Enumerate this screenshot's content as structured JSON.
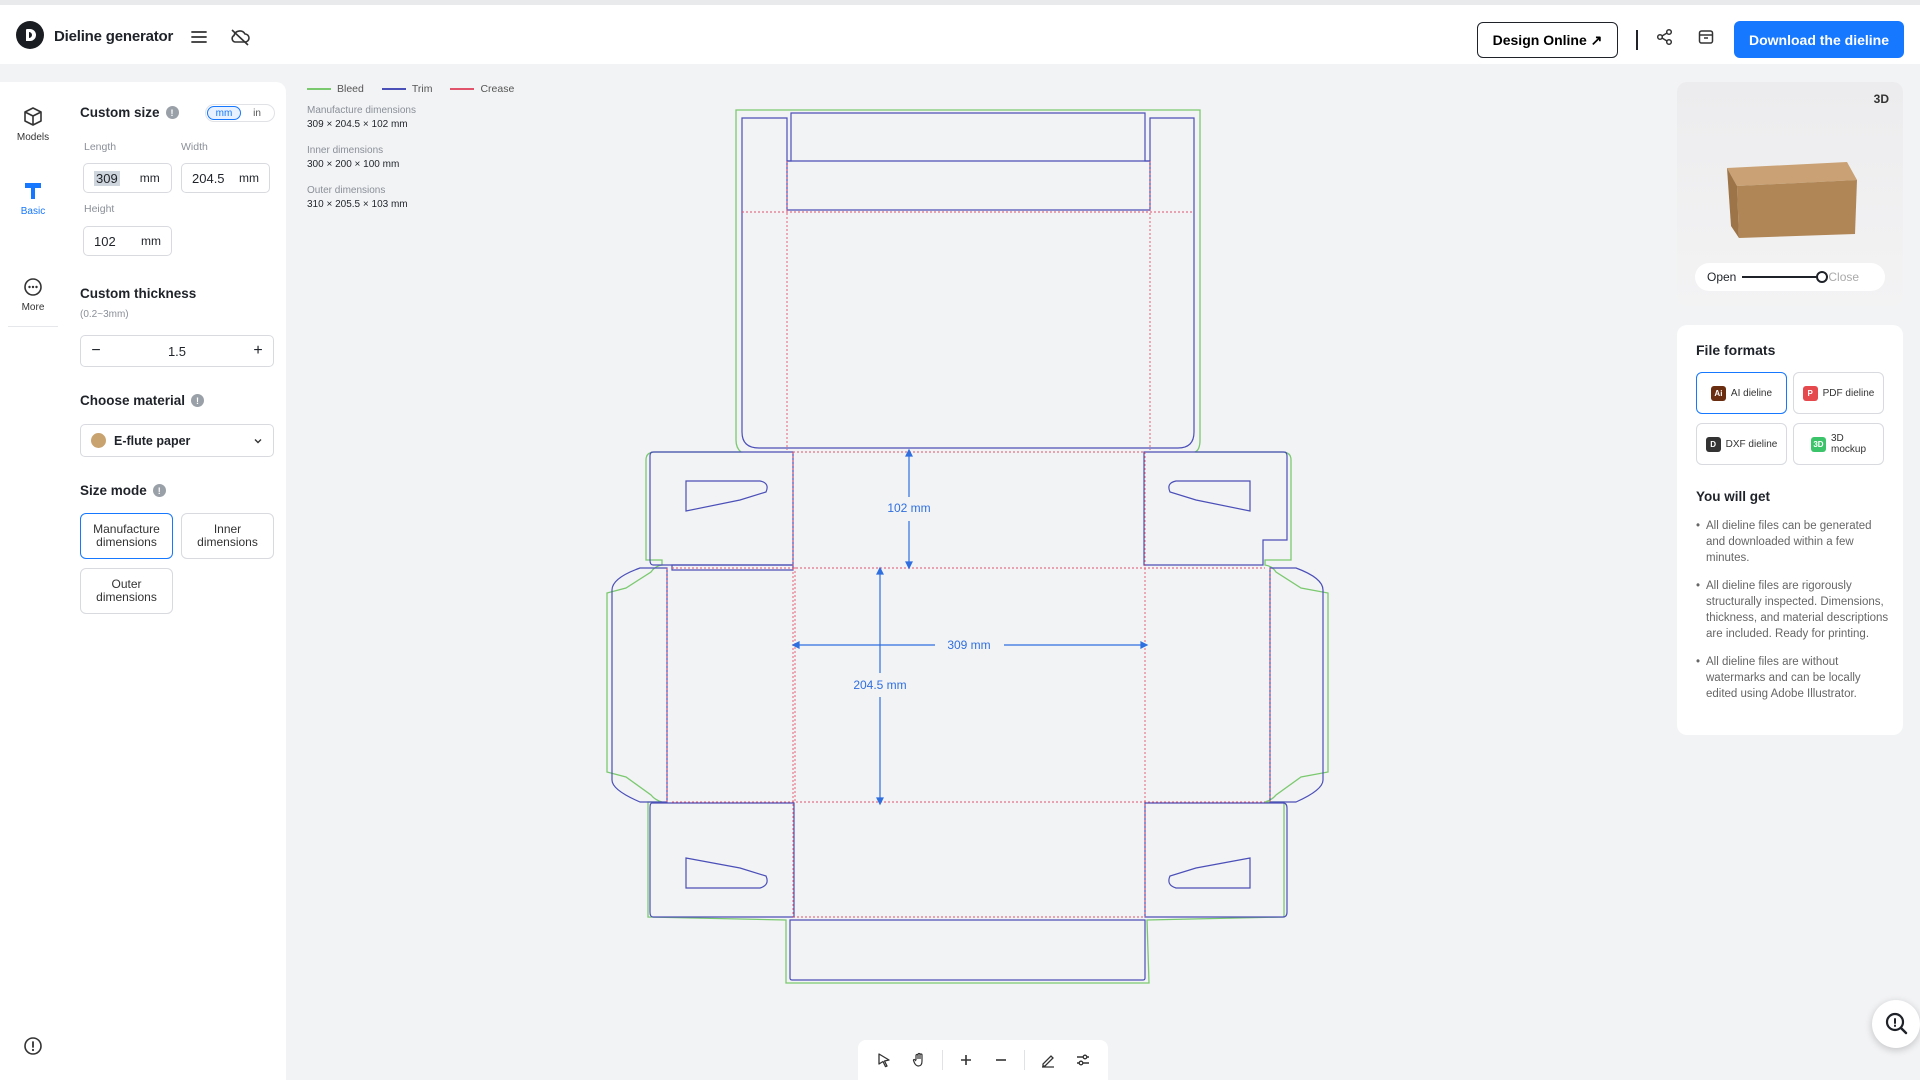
{
  "app": {
    "title": "Dieline generator",
    "design_online_label": "Design Online ↗",
    "download_label": "Download the dieline"
  },
  "rail": {
    "items": [
      {
        "label": "Models",
        "icon": "box-icon"
      },
      {
        "label": "Basic",
        "icon": "ruler-icon",
        "active": true
      },
      {
        "label": "More",
        "icon": "more-icon"
      }
    ]
  },
  "size": {
    "title": "Custom size",
    "units": [
      "mm",
      "in"
    ],
    "selected_unit": "mm",
    "length_label": "Length",
    "length_value": "309",
    "width_label": "Width",
    "width_value": "204.5",
    "height_label": "Height",
    "height_value": "102",
    "unit": "mm"
  },
  "thickness": {
    "title": "Custom thickness",
    "hint": "(0.2~3mm)",
    "value": "1.5",
    "minus": "−",
    "plus": "+"
  },
  "material": {
    "title": "Choose material",
    "value": "E-flute paper"
  },
  "size_mode": {
    "title": "Size mode",
    "options": [
      "Manufacture\ndimensions",
      "Inner\ndimensions",
      "Outer\ndimensions"
    ],
    "selected": 0
  },
  "legend": [
    {
      "label": "Bleed",
      "color": "#7bc96f"
    },
    {
      "label": "Trim",
      "color": "#4b4fb8"
    },
    {
      "label": "Crease",
      "color": "#e0536b"
    }
  ],
  "dimensions": [
    {
      "label": "Manufacture dimensions",
      "value": "309 × 204.5 × 102 mm"
    },
    {
      "label": "Inner dimensions",
      "value": "300 × 200 × 100 mm"
    },
    {
      "label": "Outer dimensions",
      "value": "310 × 205.5 × 103 mm"
    }
  ],
  "dieline_labels": {
    "height": "102 mm",
    "length": "309 mm",
    "width": "204.5 mm"
  },
  "preview": {
    "badge": "3D",
    "open_label": "Open",
    "close_label": "Close",
    "slider_value": 1
  },
  "formats": {
    "title": "File formats",
    "items": [
      {
        "label": "AI dieline",
        "icon": "ai-file-icon",
        "color": "#6b2d0f",
        "selected": true
      },
      {
        "label": "PDF dieline",
        "icon": "pdf-file-icon",
        "color": "#e5484d"
      },
      {
        "label": "DXF dieline",
        "icon": "dxf-file-icon",
        "color": "#333333"
      },
      {
        "label": "3D\nmockup",
        "icon": "mockup-file-icon",
        "color": "#3cc46b"
      }
    ],
    "you_get_title": "You will get",
    "benefits": [
      "All dieline files can be generated and downloaded within a few minutes.",
      "All dieline files are rigorously structurally inspected. Dimensions, thickness, and material descriptions are included. Ready for printing.",
      "All dieline files are without watermarks and can be locally edited using Adobe Illustrator."
    ]
  },
  "colors": {
    "accent": "#1677ff",
    "bleed": "#7bc96f",
    "trim": "#4b4fb8",
    "crease": "#e0536b",
    "dimension": "#2f6fe0"
  }
}
